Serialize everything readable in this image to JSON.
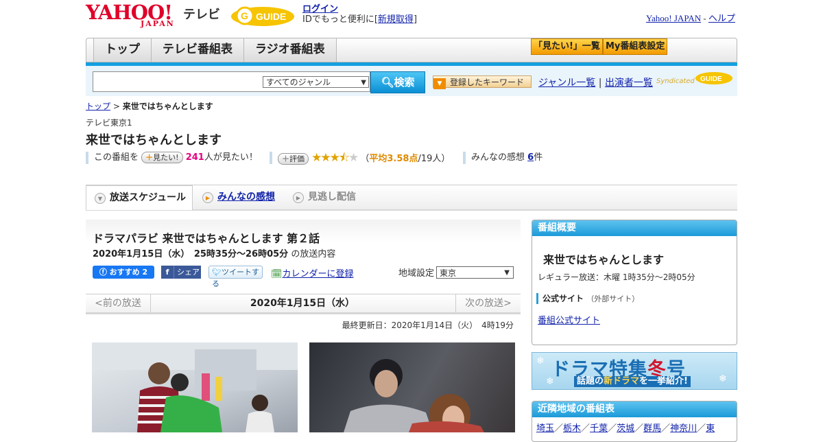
{
  "header": {
    "logo": "YAHOO!",
    "logo_sub": "JAPAN",
    "tv": "テレビ",
    "gguide": "G GUIDE",
    "login": "ログイン",
    "login_sub_pre": "IDでもっと便利に[",
    "signup": "新規取得",
    "login_sub_post": "]",
    "yahoo_japan": "Yahoo! JAPAN",
    "sep": "-",
    "help": "ヘルプ"
  },
  "nav": {
    "tabs": [
      "トップ",
      "テレビ番組表",
      "ラジオ番組表"
    ],
    "btn_mitai": "「見たい!」一覧",
    "btn_my": "My番組表設定"
  },
  "search": {
    "query": "",
    "genre": "すべてのジャンル",
    "button": "検索",
    "keyword_button": "登録したキーワード",
    "genre_list": "ジャンル一覧",
    "divider": "|",
    "performer_list": "出演者一覧",
    "syndicated": "Syndicated"
  },
  "breadcrumb": {
    "top": "トップ",
    "sep": ">",
    "current": "来世ではちゃんとします"
  },
  "program": {
    "station": "テレビ東京1",
    "title": "来世ではちゃんとします",
    "mitai_pre": "この番組を",
    "mitai_btn": "見たい!",
    "mitai_count": "241",
    "mitai_post": "人が見たい！",
    "rate_btn": "評価",
    "rating": 3.58,
    "rating_pre": "（",
    "rating_text": "平均3.58点",
    "rating_people": "/19人）",
    "impressions_pre": "みんなの感想",
    "impressions_count": "6",
    "impressions_post": "件"
  },
  "subtabs": [
    "放送スケジュール",
    "みんなの感想",
    "見逃し配信"
  ],
  "episode": {
    "title": "ドラマパラビ 来世ではちゃんとします 第２話",
    "datetime": "2020年1月15日（水）　25時35分～26時05分",
    "datetime_post": "の放送内容",
    "fb_recommend": "おすすめ 2",
    "fb_share": "シェア",
    "tweet": "ツイートする",
    "calendar": "カレンダーに登録",
    "region_label": "地域設定",
    "region_value": "東京"
  },
  "datebar": {
    "prev": "<前の放送",
    "current": "2020年1月15日（水）",
    "next": "次の放送>"
  },
  "updated": "最終更新日：2020年1月14日（火）　4時19分",
  "sidebar": {
    "overview_head": "番組概要",
    "overview_title": "来世ではちゃんとします",
    "regular": "レギュラー放送：木曜 1時35分～2時05分",
    "official_label": "公式サイト",
    "official_note": "（外部サイト）",
    "official_link": "番組公式サイト",
    "banner_main_1": "ドラマ特集",
    "banner_main_2": "冬",
    "banner_main_3": "号",
    "banner_sub_1": "話題の",
    "banner_sub_2": "新ドラマ",
    "banner_sub_3": "を一挙紹介!",
    "nearby_head": "近隣地域の番組表",
    "nearby": [
      "埼玉",
      "栃木",
      "千葉",
      "茨城",
      "群馬",
      "神奈川",
      "東"
    ]
  },
  "colors": {
    "accent_blue": "#13a0e0",
    "yahoo_red": "#e0002a",
    "pink_count": "#e6007e",
    "rating_orange": "#e08a00"
  }
}
